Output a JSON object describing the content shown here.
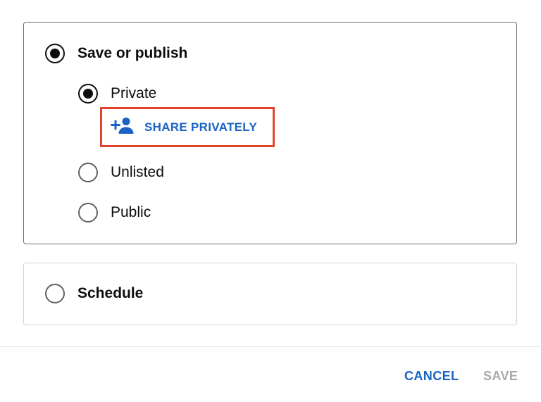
{
  "visibility_dialog": {
    "save_or_publish": {
      "label": "Save or publish",
      "selected": true,
      "options": [
        {
          "label": "Private",
          "selected": true
        },
        {
          "label": "Unlisted",
          "selected": false
        },
        {
          "label": "Public",
          "selected": false
        }
      ],
      "share_privately": {
        "label": "SHARE PRIVATELY",
        "icon": "person-add-icon"
      }
    },
    "schedule": {
      "label": "Schedule",
      "selected": false
    },
    "actions": {
      "cancel_label": "CANCEL",
      "save_label": "SAVE"
    }
  },
  "colors": {
    "accent_blue": "#1a63c4",
    "highlight_red": "#e0442a",
    "disabled_gray": "#a8a8a8"
  }
}
